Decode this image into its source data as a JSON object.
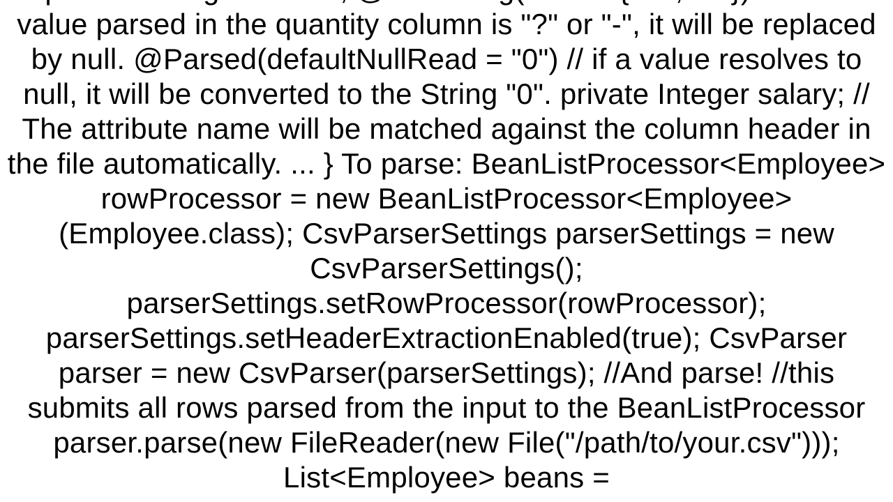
{
  "code_text": "private String textField;     @NullString(nulls = { \"?\", \"-\" }) // if the value parsed in the quantity column is \"?\" or \"-\", it will be replaced by null.     @Parsed(defaultNullRead = \"0\") // if a value resolves to null, it will be converted to the String \"0\".     private Integer salary; // The attribute name will be matched against the column header in the file automatically.     ... }  To parse: BeanListProcessor<Employee> rowProcessor = new BeanListProcessor<Employee>(Employee.class);  CsvParserSettings parserSettings = new CsvParserSettings(); parserSettings.setRowProcessor(rowProcessor); parserSettings.setHeaderExtractionEnabled(true);  CsvParser parser = new CsvParser(parserSettings);  //And parse! //this submits all rows parsed from the input to the BeanListProcessor parser.parse(new FileReader(new File(\"/path/to/your.csv\")));  List<Employee> beans ="
}
